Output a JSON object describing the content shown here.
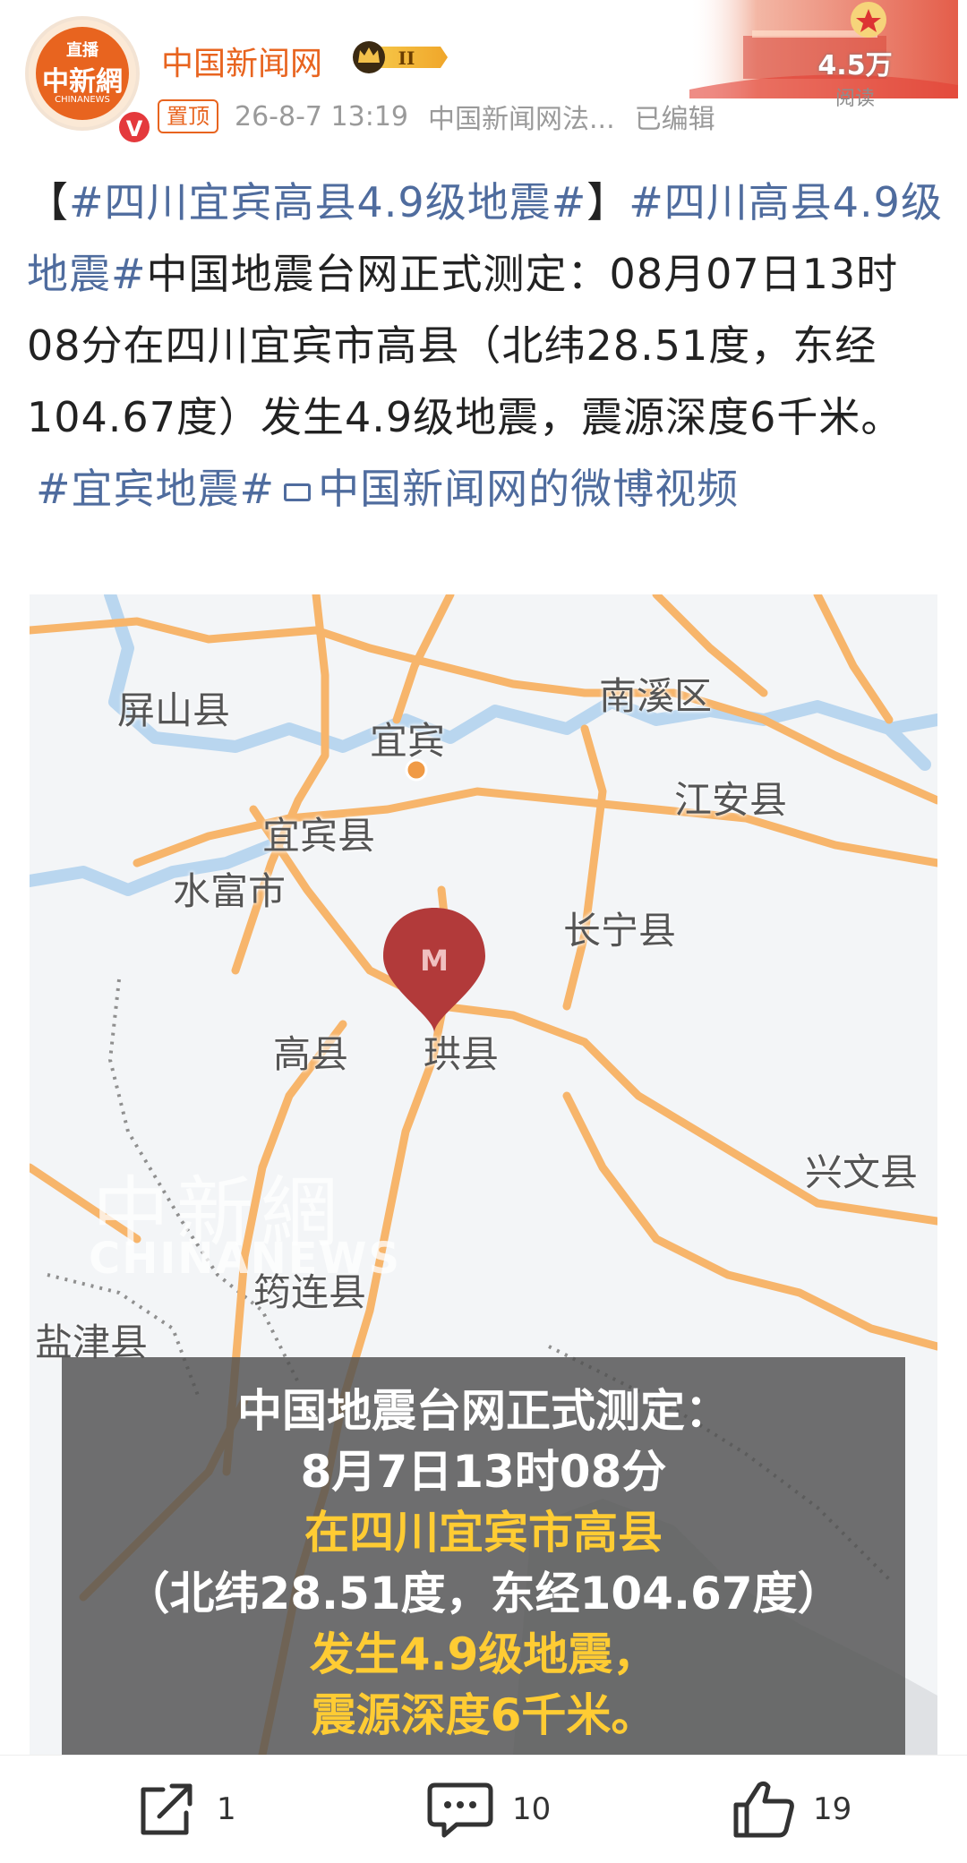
{
  "header": {
    "avatar": {
      "live_label": "直播",
      "logo_text": "中新網",
      "sub_text": "CHINANEWS",
      "verified_mark": "V"
    },
    "name": "中国新闻网",
    "level_badge": "II",
    "pin_label": "置顶",
    "timestamp": "26-8-7 13:19",
    "source": "中国新闻网法...",
    "edited": "已编辑",
    "read_count": "4.5万",
    "read_label": "阅读"
  },
  "post": {
    "tag1": "#四川宜宾高县4.9级地震#",
    "tag2": "#四川高县4.9级地震#",
    "body": "中国地震台网正式测定：08月07日13时08分在四川宜宾市高县（北纬28.51度，东经104.67度）发生4.9级地震，震源深度6千米。",
    "tag3": "#宜宾地震#",
    "video_link": "中国新闻网的微博视频"
  },
  "map": {
    "places": [
      "屏山县",
      "宜宾",
      "南溪区",
      "江安县",
      "宜宾县",
      "水富市",
      "长宁县",
      "高县",
      "珙县",
      "兴文县",
      "筠连县",
      "盐津县"
    ],
    "marker_letter": "M",
    "watermark": "中新網",
    "watermark_sub": "CHINANEWS",
    "caption_lines": [
      "中国地震台网正式测定：",
      "8月7日13时08分",
      "在四川宜宾市高县",
      "（北纬28.51度，东经104.67度）",
      "发生4.9级地震，",
      "震源深度6千米。"
    ]
  },
  "actions": {
    "share_count": "1",
    "comment_count": "10",
    "like_count": "19"
  },
  "colors": {
    "brand_orange": "#e8641f",
    "tag_blue": "#4f6c9e",
    "road_orange": "#f7b56b",
    "river_blue": "#b9d6ef",
    "marker_red": "#b23a3a",
    "caption_yellow": "#ffcc33"
  }
}
